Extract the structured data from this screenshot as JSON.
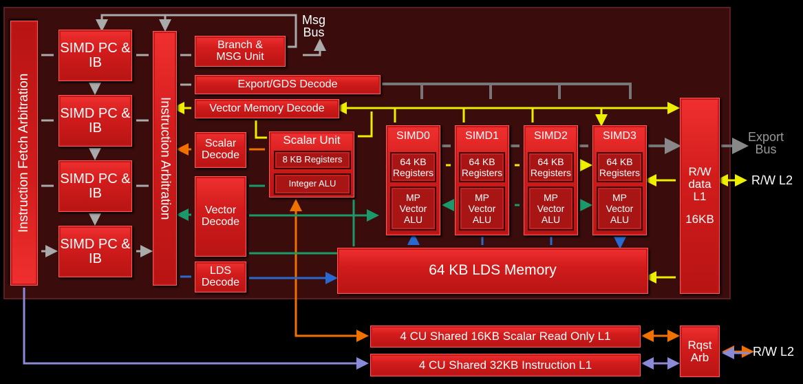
{
  "labels": {
    "instruction_fetch_arbitration": "Instruction Fetch Arbitration",
    "simd_pc_ib": [
      "SIMD PC & IB",
      "SIMD PC & IB",
      "SIMD PC & IB",
      "SIMD PC & IB"
    ],
    "instruction_arbitration": "Instruction Arbitration",
    "branch_msg_unit": "Branch & MSG Unit",
    "export_gds_decode": "Export/GDS Decode",
    "vector_memory_decode": "Vector Memory Decode",
    "scalar_decode": "Scalar Decode",
    "vector_decode": "Vector Decode",
    "lds_decode": "LDS Decode",
    "scalar_unit": "Scalar Unit",
    "scalar_registers": "8 KB Registers",
    "integer_alu": "Integer ALU",
    "simds": [
      {
        "name": "SIMD0",
        "registers": "64 KB Registers",
        "alu": "MP Vector ALU"
      },
      {
        "name": "SIMD1",
        "registers": "64 KB Registers",
        "alu": "MP Vector ALU"
      },
      {
        "name": "SIMD2",
        "registers": "64 KB Registers",
        "alu": "MP Vector ALU"
      },
      {
        "name": "SIMD3",
        "registers": "64 KB Registers",
        "alu": "MP Vector ALU"
      }
    ],
    "lds_memory": "64 KB LDS Memory",
    "rw_data_l1": "R/W data L1",
    "rw_data_l1_size": "16KB",
    "scalar_l1": "4 CU Shared 16KB Scalar Read Only L1",
    "instruction_l1": "4 CU Shared 32KB Instruction L1",
    "rqst_arb": "Rqst Arb",
    "msg_bus": "Msg Bus",
    "export_bus": "Export Bus",
    "rw_l2_top": "R/W L2",
    "rw_l2_bottom": "R/W L2"
  },
  "colors": {
    "block": "#d42020",
    "panel": "#3a0c0c",
    "gray_arrow": "#8a8a8a",
    "yellow_arrow": "#e8e000",
    "orange_arrow": "#f07000",
    "green_arrow": "#1a9a6a",
    "blue_arrow": "#2a6ad0",
    "purple_arrow": "#7a7ac8"
  }
}
